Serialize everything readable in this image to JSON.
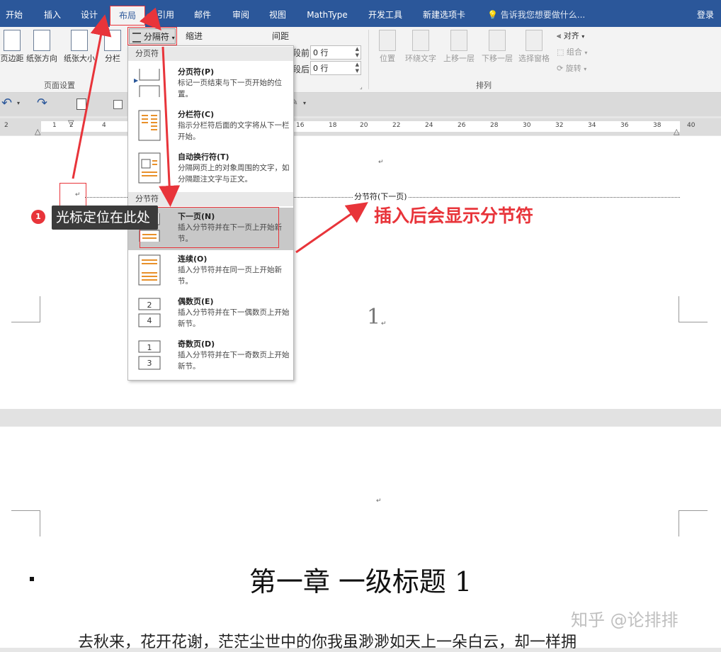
{
  "tabs": [
    "开始",
    "插入",
    "设计",
    "布局",
    "引用",
    "邮件",
    "审阅",
    "视图",
    "MathType",
    "开发工具",
    "新建选项卡"
  ],
  "active_tab": "布局",
  "search_tip": "告诉我您想要做什么...",
  "login": "登录",
  "ribbon": {
    "page_setup": {
      "margins": "页边距",
      "orientation": "纸张方向",
      "size": "纸张大小",
      "columns": "分栏",
      "group_label": "页面设置"
    },
    "breaks_button": "分隔符",
    "indent_label": "缩进",
    "spacing_label": "间距",
    "before_label": "段前:",
    "before_value": "0 行",
    "after_label": "段后:",
    "after_value": "0 行",
    "arrange": {
      "position": "位置",
      "wrap_text": "环绕文字",
      "bring_forward": "上移一层",
      "send_backward": "下移一层",
      "selection_pane": "选择窗格",
      "align": "对齐",
      "group": "组合",
      "rotate": "旋转",
      "group_label": "排列"
    }
  },
  "ruler_ticks": [
    "2",
    "1",
    "2",
    "4",
    "16",
    "18",
    "20",
    "22",
    "24",
    "26",
    "28",
    "30",
    "32",
    "34",
    "36",
    "38",
    "40"
  ],
  "menu": {
    "page_breaks_header": "分页符",
    "section_breaks_header": "分节符",
    "items": [
      {
        "title": "分页符(P)",
        "desc": "标记一页结束与下一页开始的位置。"
      },
      {
        "title": "分栏符(C)",
        "desc": "指示分栏符后面的文字将从下一栏开始。"
      },
      {
        "title": "自动换行符(T)",
        "desc": "分隔网页上的对象周围的文字，如分隔题注文字与正文。"
      },
      {
        "title": "下一页(N)",
        "desc": "插入分节符并在下一页上开始新节。"
      },
      {
        "title": "连续(O)",
        "desc": "插入分节符并在同一页上开始新节。"
      },
      {
        "title": "偶数页(E)",
        "desc": "插入分节符并在下一偶数页上开始新节。"
      },
      {
        "title": "奇数页(D)",
        "desc": "插入分节符并在下一奇数页上开始新节。"
      }
    ]
  },
  "document": {
    "section_break_label": "分节符(下一页)",
    "page_number": "1",
    "paragraph_mark": "↵",
    "heading": "第一章 一级标题 1",
    "body_text": "去秋来，花开花谢，茫茫尘世中的你我虽渺渺如天上一朵白云，却一样拥"
  },
  "annotations": {
    "badge_number": "1",
    "cursor_callout": "光标定位在此处",
    "section_note": "插入后会显示分节符"
  },
  "watermark": "知乎 @论排排",
  "colors": {
    "ribbon_blue": "#2b579a",
    "annotation_red": "#e8343a"
  }
}
